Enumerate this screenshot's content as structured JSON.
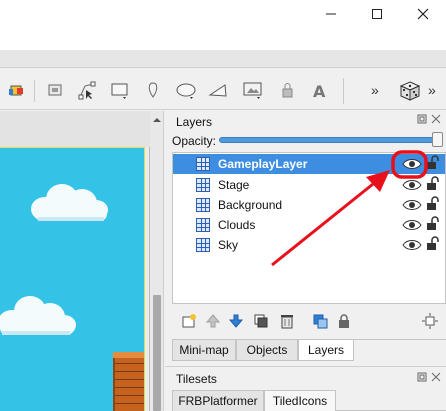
{
  "window": {
    "minimize_icon": "minimize-icon",
    "maximize_icon": "maximize-icon",
    "close_icon": "close-icon"
  },
  "toolbar": {
    "icons": [
      "paint-bucket-icon",
      "stamp-icon",
      "select-nodes-icon",
      "rectangle-icon",
      "ellipse-point-icon",
      "ellipse-icon",
      "polygon-icon",
      "image-icon",
      "insert-tile-icon",
      "text-icon"
    ],
    "overflow_left": "»",
    "overflow_right": "»",
    "random_icon": "dice-icon"
  },
  "layers_panel": {
    "title": "Layers",
    "opacity_label": "Opacity:",
    "opacity_value": 1.0,
    "layers": [
      {
        "name": "GameplayLayer",
        "selected": true,
        "visible": true,
        "locked": false
      },
      {
        "name": "Stage",
        "selected": false,
        "visible": true,
        "locked": false
      },
      {
        "name": "Background",
        "selected": false,
        "visible": true,
        "locked": false
      },
      {
        "name": "Clouds",
        "selected": false,
        "visible": true,
        "locked": false
      },
      {
        "name": "Sky",
        "selected": false,
        "visible": true,
        "locked": false
      }
    ],
    "tools": [
      "new-layer-icon",
      "move-up-icon",
      "move-down-icon",
      "duplicate-icon",
      "delete-icon",
      "merge-icon",
      "lock-icon",
      "highlight-icon"
    ],
    "tabs": [
      "Mini-map",
      "Objects",
      "Layers"
    ],
    "active_tab": "Layers"
  },
  "tilesets_panel": {
    "title": "Tilesets",
    "tabs": [
      "FRBPlatformer",
      "TiledIcons"
    ],
    "active_tab": "TiledIcons"
  },
  "annotation": {
    "color": "#e8101a"
  }
}
